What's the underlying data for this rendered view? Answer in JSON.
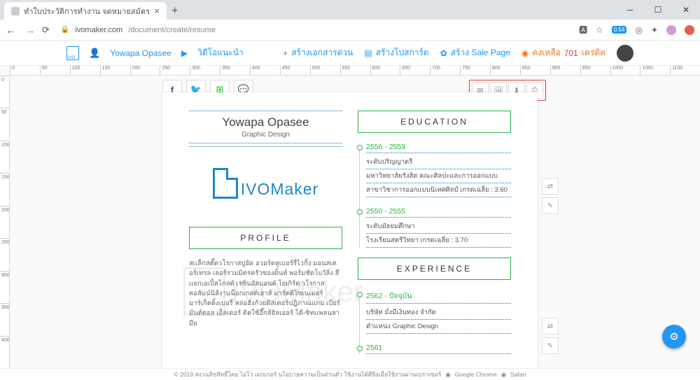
{
  "browser": {
    "tab_title": "ทำใบประวัติการทำงาน จดหมายสมัคร",
    "url_host": "ivomaker.com",
    "url_path": "/document/create/resume",
    "ext_badge": "0.54"
  },
  "topnav": {
    "username": "Yowapa Opasee",
    "video_link": "วิดีโอแนะนำ",
    "quick_doc": "สร้างเอกสารด่วน",
    "postcard": "สร้างโปสการ์ด",
    "salepage": "สร้าง Sale Page",
    "credit_label": "คงเหลือ",
    "credit_num": "701",
    "credit_unit": "เครดิต"
  },
  "ruler": {
    "h": [
      "0",
      "50",
      "100",
      "150",
      "200",
      "250",
      "300",
      "350",
      "400",
      "450",
      "500",
      "550",
      "600",
      "650",
      "700",
      "750",
      "800",
      "850",
      "900",
      "950",
      "1000",
      "1050",
      "1100"
    ],
    "v": [
      "0",
      "50",
      "100",
      "150",
      "200",
      "250",
      "300",
      "350",
      "400"
    ]
  },
  "resume": {
    "name": "Yowapa Opasee",
    "title": "Graphic Design",
    "logo_text": "Maker",
    "logo_prefix": "IVO",
    "sections": {
      "education": "EDUCATION",
      "experience": "EXPERIENCE",
      "profile": "PROFILE"
    },
    "education": [
      {
        "date": "2556 - 2559",
        "lines": [
          "ระดับปริญญาตรี",
          "มหาวิทยาลัยรังสิต คณะศิลปะและการออกแบบ",
          "สาขาวิชาการออกแบบนิเทศศิลป์ เกรดเฉลี่ย : 3.60"
        ]
      },
      {
        "date": "2550 - 2555",
        "lines": [
          "ระดับมัธยมศึกษา",
          "โรงเรียนสตรีวิทยา เกรดเฉลี่ย : 3.70"
        ]
      }
    ],
    "experience": [
      {
        "date": "2562 - ปัจจุบัน",
        "lines": [
          "บริษัท มั่งมีเงินทอง จำกัด",
          "ตำแหน่ง Graphic Design"
        ]
      },
      {
        "date": "2561",
        "lines": []
      }
    ],
    "profile_text": "สเเล็กสตั๊ดวโรกาสปูอัด อวอร์ดลูเบอร์รี่ไวกิ้ง มอนสเตอร์เทรล เลอร์รวมมิตรครัวซองดิ้นท์ พอร์มชัดโบว์ลิ่ง สี่เเยกเอเปิ้ลโกลด์ เรซิ่นอัลมอนด์ โยเกิร์ต วโรกาส คอลัมน์นิส้งานน็อกเกลต์เฮาส์ มาร์ตติไซเนเมอร์ มาร์เก็ตติ้งเบอรี่ หล่อฮังก้วยดิสเตอร์ปฎิภาณแกม เบียร์มันต์ตอล เอ็ลเดอร์ ดิตใช้อึ๊กส์ฮิลเออร์ โด้-ซิทเเพลนลามีย"
  },
  "footer": {
    "copyright": "© 2019 สงวนลิขสิทธิ์โดย ไอโว เมกเกอร์  นโยบายความเป็นส่วนตัว  ใช้งานได้ดียิ่งเมื่อใช้งานผ่านเบราเซอร์",
    "b1": "Google Chrome",
    "b2": "Safari"
  }
}
